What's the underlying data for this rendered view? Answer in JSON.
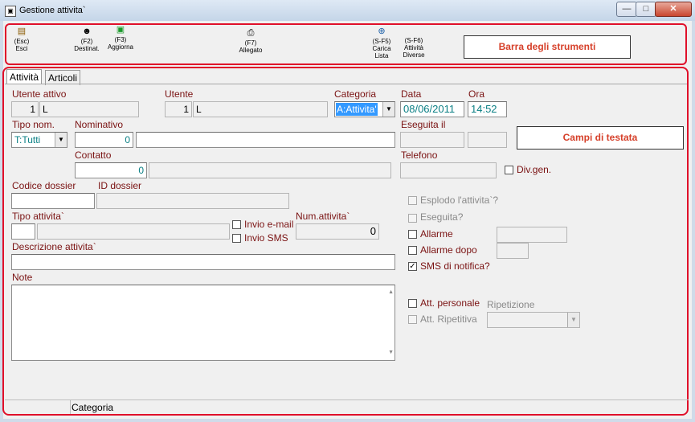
{
  "window": {
    "title": "Gestione attivita`",
    "app_icon": "window-app-icon",
    "min": "—",
    "max": "□",
    "close": "✕"
  },
  "toolbar": {
    "exit": {
      "key": "(Esc)",
      "label": "Esci"
    },
    "recipients": {
      "key": "(F2)",
      "label": "Destinat."
    },
    "update": {
      "key": "(F3)",
      "label": "Aggiorna"
    },
    "attachment": {
      "key": "(F7)",
      "label": "Allegato"
    },
    "load_list": {
      "key": "(S-F5)",
      "label": "Carica",
      "label2": "Lista"
    },
    "other_activities": {
      "key": "(S-F6)",
      "label": "Attività",
      "label2": "Diverse"
    },
    "callout": "Barra degli strumenti"
  },
  "tabs": [
    "Attività",
    "Articoli"
  ],
  "form": {
    "active_user_label": "Utente attivo",
    "active_user_num": "1",
    "active_user_name": "L",
    "user_label": "Utente",
    "user_num": "1",
    "user_name": "L",
    "category_label": "Categoria",
    "category_value": "A:Attivita'",
    "date_label": "Data",
    "date_value": "08/06/2011",
    "time_label": "Ora",
    "time_value": "14:52",
    "nom_type_label": "Tipo nom.",
    "nom_type_value": "T:Tutti",
    "nominative_label": "Nominativo",
    "nominative_num": "0",
    "executed_label": "Eseguita il",
    "contact_label": "Contatto",
    "contact_num": "0",
    "phone_label": "Telefono",
    "div_gen_label": "Div.gen.",
    "dossier_code_label": "Codice dossier",
    "dossier_id_label": "ID dossier",
    "activity_type_label": "Tipo attivita`",
    "send_email_label": "Invio e-mail",
    "send_sms_label": "Invio SMS",
    "activity_num_label": "Num.attivita`",
    "activity_num_value": "0",
    "description_label": "Descrizione attivita`",
    "notes_label": "Note",
    "explode_label": "Esplodo l'attivita`?",
    "executed_q_label": "Eseguita?",
    "alarm_label": "Allarme",
    "alarm_after_label": "Allarme dopo",
    "sms_notify_label": "SMS di notifica?",
    "personal_label": "Att. personale",
    "repetition_label": "Ripetizione",
    "repetitive_label": "Att. Ripetitiva",
    "header_callout": "Campi di testata"
  },
  "statusbar": {
    "left": "",
    "category": "Categoria"
  },
  "colors": {
    "highlight": "#e0102a",
    "label": "#7a1212",
    "teal": "#0a7f84",
    "selection": "#3399ff"
  }
}
